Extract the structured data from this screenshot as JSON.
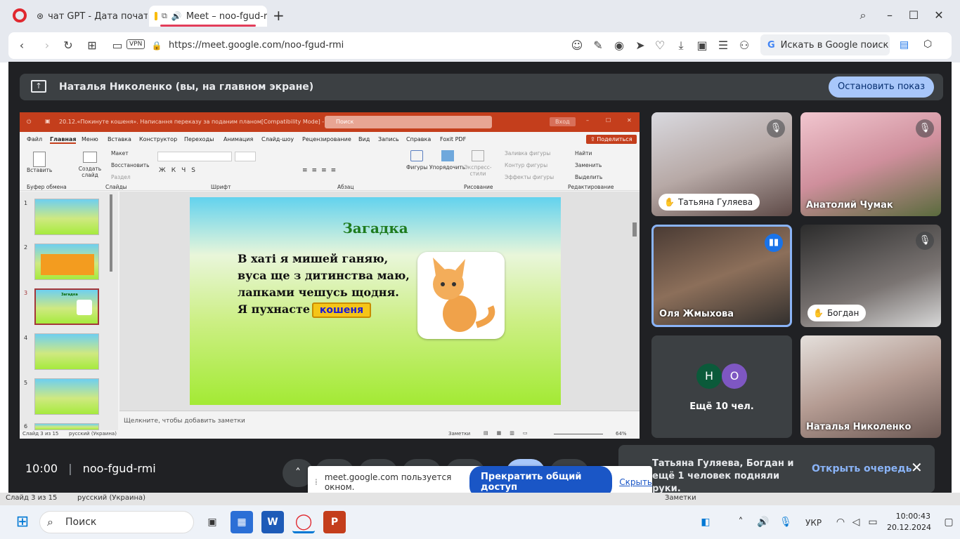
{
  "browser": {
    "tabs": [
      {
        "label": "чат GPT - Дата початку к"
      },
      {
        "label": "Meet – noo-fgud-r"
      }
    ],
    "new_tab": "+",
    "vpn": "VPN",
    "url": "https://meet.google.com/noo-fgud-rmi",
    "google_search": "Искать в Google поиск"
  },
  "meet": {
    "presenting_title": "Наталья Николенко (вы, на главном экране)",
    "stop_presenting": "Остановить показ",
    "time": "10:00",
    "meeting_code": "noo-fgud-rmi",
    "participants": [
      {
        "name": "Татьяна Гуляева",
        "muted": true,
        "hand_raised": true
      },
      {
        "name": "Анатолий Чумак",
        "muted": true
      },
      {
        "name": "Оля Жмыхова",
        "speaking": true
      },
      {
        "name": "Богдан",
        "muted": true,
        "hand_raised": true
      },
      {
        "name": "Наталья Николенко"
      }
    ],
    "more_avatars": [
      "Н",
      "О"
    ],
    "more_label": "Ещё 10 чел.",
    "hands_text": "Татьяна Гуляева, Богдан и ещё 1 человек подняли руки.",
    "open_queue": "Открыть очередь",
    "share_banner_text": "meet.google.com пользуется окном.",
    "stop_sharing": "Прекратить общий доступ",
    "hide": "Скрыть"
  },
  "ppt": {
    "title": "20.12.«Покинуте кошеня». Написання переказу за поданим планом[Compatibility Mode] - PowerPoint",
    "search_placeholder": "Поиск",
    "login": "Вход",
    "share": "Поделиться",
    "menu": [
      "Файл",
      "Главная",
      "Меню",
      "Вставка",
      "Конструктор",
      "Переходы",
      "Анимация",
      "Слайд-шоу",
      "Рецензирование",
      "Вид",
      "Запись",
      "Справка",
      "Foxit PDF"
    ],
    "ribbon_groups": [
      "Буфер обмена",
      "Слайды",
      "Шрифт",
      "Абзац",
      "Рисование",
      "Редактирование"
    ],
    "ribbon_items": {
      "paste": "Вставить",
      "create_slide": "Создать слайд",
      "layout": "Макет",
      "restore": "Восстановить",
      "section": "Раздел",
      "shapes": "Фигуры",
      "arrange": "Упорядочить",
      "express": "Экспресс-стили",
      "fill": "Заливка фигуры",
      "outline": "Контур фигуры",
      "effects": "Эффекты фигуры",
      "find": "Найти",
      "replace": "Заменить",
      "select": "Выделить"
    },
    "thumb_numbers": [
      "1",
      "2",
      "3",
      "4",
      "5",
      "6"
    ],
    "thumb_titles": [
      "",
      "",
      "Загадка",
      "",
      "",
      ""
    ],
    "slide": {
      "title": "Загадка",
      "lines": [
        "В хаті я мишей ганяю,",
        "вуса ще з дитинства маю,",
        "лапками чешусь щодня.",
        "Я пухнасте"
      ],
      "answer": "кошеня"
    },
    "notes_placeholder": "Щелкните, чтобы добавить заметки",
    "status_slide": "Слайд 3 из 15",
    "status_lang": "русский (Украина)",
    "status_notes": "Заметки",
    "zoom": "64%"
  },
  "taskbar": {
    "search": "Поиск",
    "lang": "УКР",
    "clock_time": "10:00:43",
    "clock_date": "20.12.2024",
    "behind_status_left": "Слайд 3 из 15",
    "behind_status_lang": "русский (Украина)",
    "behind_status_notes": "Заметки"
  },
  "colors": {
    "accent_blue": "#a8c7fa",
    "opera_red": "#e33d5a",
    "ppt_orange": "#c43e1c",
    "meet_bg": "#202124"
  }
}
